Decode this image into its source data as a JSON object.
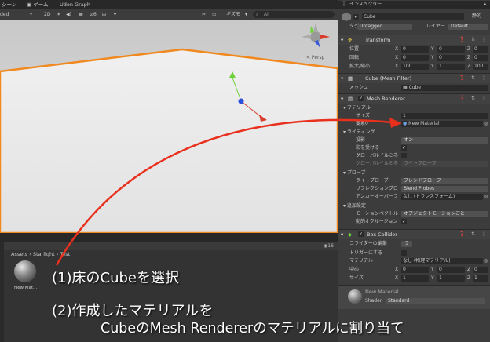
{
  "tabs": {
    "scene": "シーン",
    "game": "ゲーム",
    "udon": "Udon Graph"
  },
  "scene_toolbar": {
    "shading": "ded",
    "mode2d": "2D",
    "gizmos": "ギズモ",
    "search": "All",
    "persp": "< Persp",
    "count": "6"
  },
  "project": {
    "breadcrumb": "Assets › Starlight › Test",
    "asset_label": "New Mat...",
    "count": "16"
  },
  "inspector": {
    "title": "インスペクター",
    "object_name": "Cube",
    "static_label": "静的",
    "tag_label": "タグ",
    "tag_value": "Untagged",
    "layer_label": "レイヤー",
    "layer_value": "Default",
    "transform": {
      "title": "Transform",
      "pos_label": "位置",
      "rot_label": "回転",
      "scale_label": "拡大/縮小",
      "pos": [
        "0",
        "0",
        "0"
      ],
      "rot": [
        "0",
        "0",
        "0"
      ],
      "scale": [
        "100",
        "1",
        "100"
      ]
    },
    "mesh_filter": {
      "title": "Cube (Mesh Filter)",
      "mesh_label": "メッシュ",
      "mesh_value": "Cube"
    },
    "mesh_renderer": {
      "title": "Mesh Renderer",
      "materials_label": "マテリアル",
      "size_label": "サイズ",
      "size_value": "1",
      "element_label": "要素0",
      "element_value": "New Material",
      "lighting_label": "ライティング",
      "cast_label": "投影",
      "cast_value": "オン",
      "receive_label": "影を受ける",
      "gi_label": "グローバルイルミネ",
      "gi2_label": "グローバルイルミネ",
      "gi2_value": "ライトプローブ",
      "probes_label": "プローブ",
      "lp_label": "ライトプローブ",
      "lp_value": "ブレンドプローブ",
      "rp_label": "リフレクションプロ",
      "rp_value": "Blend Probes",
      "anchor_label": "アンカーオーバーラ",
      "anchor_value": "なし (トランスフォーム)",
      "add_label": "追加設定",
      "motion_label": "モーションベクトル",
      "motion_value": "オブジェクトモーションごと",
      "occl_label": "動的オクルージョン"
    },
    "box_collider": {
      "title": "Box Collider",
      "edit_label": "コライダーの編集",
      "trigger_label": "トリガーにする",
      "material_label": "マテリアル",
      "material_value": "なし (物理マテリアル)",
      "center_label": "中心",
      "center": [
        "0",
        "0",
        "0"
      ],
      "size_label": "サイズ",
      "size": [
        "1",
        "1",
        "1"
      ]
    },
    "material": {
      "name": "New Material",
      "shader_label": "Shader",
      "shader_value": "Standard"
    }
  },
  "axes": {
    "x": "X",
    "y": "Y",
    "z": "Z"
  },
  "overlay": {
    "step1": "(1)床のCubeを選択",
    "step2": "(2)作成したマテリアルを",
    "step3": "CubeのMesh Rendererのマテリアルに割り当て"
  },
  "colors": {
    "accent_arrow": "#e8301c",
    "selection_outline": "#f08a20",
    "scene_floor": "#ececec"
  }
}
